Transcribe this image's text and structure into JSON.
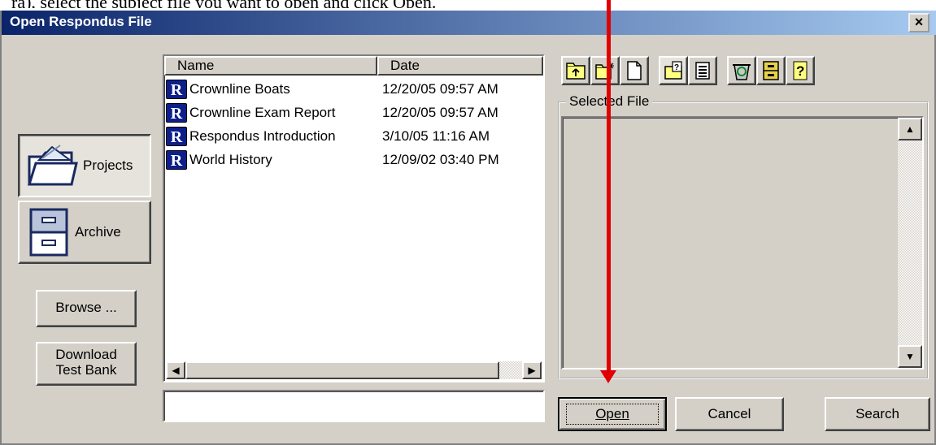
{
  "window": {
    "title": "Open Respondus File",
    "close_label": "×"
  },
  "doc_fragment": "ra), select the subject file you want to open and click Open.",
  "nav": {
    "projects_label": "Projects",
    "archive_label": "Archive",
    "browse_label": "Browse ...",
    "download_label_1": "Download",
    "download_label_2": "Test Bank"
  },
  "file_list": {
    "columns": [
      "Name",
      "Date"
    ],
    "rows": [
      {
        "name": "Crownline Boats",
        "date": "12/20/05  09:57 AM"
      },
      {
        "name": "Crownline Exam Report",
        "date": "12/20/05  09:57 AM"
      },
      {
        "name": "Respondus Introduction",
        "date": "3/10/05  11:16 AM"
      },
      {
        "name": "World History",
        "date": "12/09/02  03:40 PM"
      }
    ],
    "row_icon_glyph": "R",
    "filename_value": ""
  },
  "toolbar": {
    "icons": [
      "folder-up-icon",
      "new-folder-icon",
      "new-file-icon",
      "properties-icon",
      "details-view-icon",
      "recycle-icon",
      "archive-box-icon",
      "help-icon"
    ]
  },
  "selected_file": {
    "legend": "Selected File",
    "content": ""
  },
  "actions": {
    "open_label": "Open",
    "cancel_label": "Cancel",
    "search_label": "Search"
  },
  "colors": {
    "title_gradient_start": "#0a246a",
    "title_gradient_end": "#a6caf0",
    "face": "#d4d0c8",
    "annotation_arrow": "#e00000",
    "r_icon": "#0c1f8a"
  }
}
